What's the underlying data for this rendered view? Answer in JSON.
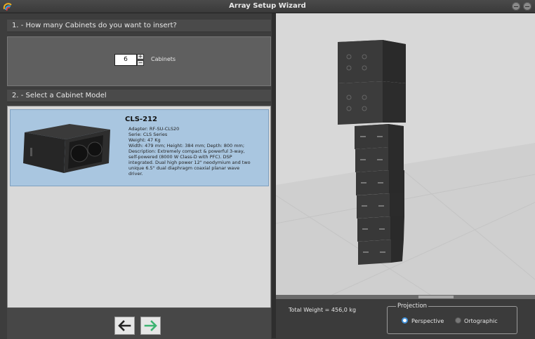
{
  "window": {
    "title": "Array Setup Wizard"
  },
  "step1": {
    "title": "1. -  How many Cabinets do you want to insert?",
    "value": "6",
    "unit_label": "Cabinets",
    "plus": "+",
    "minus": "−"
  },
  "step2": {
    "title": "2. -  Select a Cabinet Model"
  },
  "model": {
    "name": "CLS-212",
    "details": [
      "Adapter: RF-SU-CLS20",
      "Serie: CLS Series",
      "Weight: 47 Kg",
      "Width: 479 mm; Height: 384 mm; Depth: 800 mm;",
      "Description: Extremely compact & powerful 3-way,",
      "self-powered (8000 W Class-D with PFC). DSP",
      "integrated. Dual high power 12\" neodymium and two",
      "unique 6.5\" dual diaphragm coaxial planar wave",
      "driver."
    ]
  },
  "status": {
    "total_weight": "Total Weight = 456,0 kg"
  },
  "projection": {
    "title": "Projection",
    "options": [
      "Perspective",
      "Ortographic"
    ],
    "selected": "Perspective"
  },
  "colors": {
    "accent": "#3f8fd8",
    "selection": "#a9c6e0",
    "next_arrow": "#3cb371"
  },
  "icons": {
    "back": "arrow-left-icon",
    "next": "arrow-right-icon",
    "app": "app-logo-icon"
  }
}
